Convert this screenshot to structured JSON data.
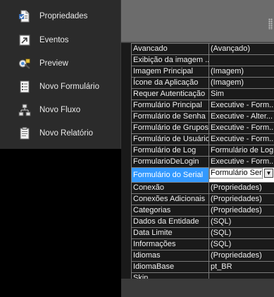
{
  "menu": {
    "items": [
      {
        "label": "Propriedades",
        "icon": "properties-icon"
      },
      {
        "label": "Eventos",
        "icon": "events-icon"
      },
      {
        "label": "Preview",
        "icon": "preview-icon"
      },
      {
        "label": "Novo Formulário",
        "icon": "new-form-icon"
      },
      {
        "label": "Novo Fluxo",
        "icon": "new-flow-icon"
      },
      {
        "label": "Novo Relatório",
        "icon": "new-report-icon"
      }
    ]
  },
  "properties": {
    "rows": [
      {
        "name": "Avancado",
        "value": "(Avançado)"
      },
      {
        "name": "Exibição da imagem ...",
        "value": ""
      },
      {
        "name": "Imagem Principal",
        "value": "(Imagem)"
      },
      {
        "name": "Ícone da Aplicação",
        "value": "(Imagem)"
      },
      {
        "name": "Requer Autenticação",
        "value": "Sim"
      },
      {
        "name": "Formulário Principal",
        "value": "Executive - Form..."
      },
      {
        "name": "Formulário de Senha",
        "value": "Executive - Alter..."
      },
      {
        "name": "Formulário de Grupos",
        "value": "Executive - Form..."
      },
      {
        "name": "Formulário de Usuários",
        "value": "Executive - Form..."
      },
      {
        "name": "Formulário de Log",
        "value": "Formulário de Log"
      },
      {
        "name": "FormularioDeLogin",
        "value": "Executive - Form..."
      },
      {
        "name": "Formulário do Serial",
        "value": "Formulário Serial"
      },
      {
        "name": "Conexão",
        "value": "(Propriedades)"
      },
      {
        "name": "Conexões Adicionais",
        "value": "(Propriedades)"
      },
      {
        "name": "Categorias",
        "value": "(Propriedades)"
      },
      {
        "name": "Dados da Entidade",
        "value": "(SQL)"
      },
      {
        "name": "Data Limite",
        "value": "(SQL)"
      },
      {
        "name": "Informações",
        "value": "(SQL)"
      },
      {
        "name": "Idiomas",
        "value": "(Propriedades)"
      },
      {
        "name": "IdiomaBase",
        "value": "pt_BR"
      },
      {
        "name": "Skin",
        "value": ""
      }
    ],
    "selected_row": 11
  },
  "colors": {
    "selection": "#3399ff",
    "menu_bg": "#2b2b2b",
    "panel_header": "#6c6c6c"
  }
}
